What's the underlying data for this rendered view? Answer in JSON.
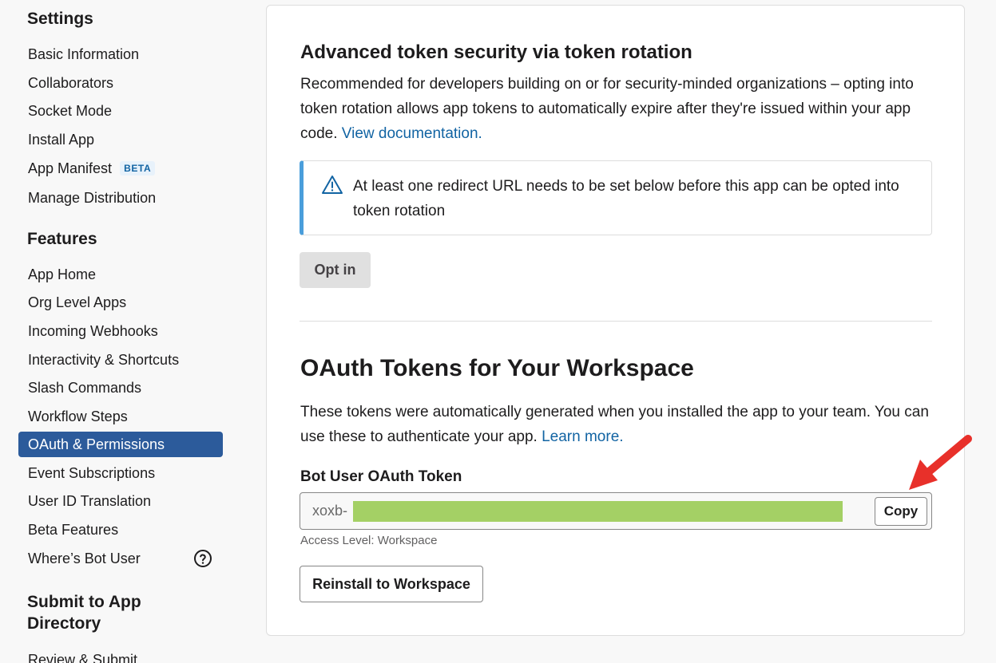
{
  "sidebar": {
    "settings_heading": "Settings",
    "settings_items": [
      {
        "label": "Basic Information"
      },
      {
        "label": "Collaborators"
      },
      {
        "label": "Socket Mode"
      },
      {
        "label": "Install App"
      },
      {
        "label": "App Manifest",
        "badge": "BETA"
      },
      {
        "label": "Manage Distribution"
      }
    ],
    "features_heading": "Features",
    "features_items": [
      {
        "label": "App Home"
      },
      {
        "label": "Org Level Apps"
      },
      {
        "label": "Incoming Webhooks"
      },
      {
        "label": "Interactivity & Shortcuts"
      },
      {
        "label": "Slash Commands"
      },
      {
        "label": "Workflow Steps"
      },
      {
        "label": "OAuth & Permissions",
        "active": true
      },
      {
        "label": "Event Subscriptions"
      },
      {
        "label": "User ID Translation"
      },
      {
        "label": "Beta Features"
      },
      {
        "label": "Where’s Bot User"
      }
    ],
    "submit_heading_line1": "Submit to App",
    "submit_heading_line2": "Directory",
    "submit_items": [
      {
        "label": "Review & Submit"
      }
    ]
  },
  "token_rotation": {
    "title": "Advanced token security via token rotation",
    "description": "Recommended for developers building on or for security-minded organizations – opting into token rotation allows app tokens to automatically expire after they're issued within your app code.",
    "doc_link": "View documentation.",
    "notice": "At least one redirect URL needs to be set below before this app can be opted into token rotation",
    "opt_in_label": "Opt in"
  },
  "oauth_tokens": {
    "title": "OAuth Tokens for Your Workspace",
    "description": "These tokens were automatically generated when you installed the app to your team. You can use these to authenticate your app.",
    "learn_more": "Learn more.",
    "bot_token_label": "Bot User OAuth Token",
    "token_prefix": "xoxb-",
    "copy_label": "Copy",
    "access_level": "Access Level: Workspace",
    "reinstall_label": "Reinstall to Workspace"
  },
  "colors": {
    "active_nav": "#2c5b9b",
    "link": "#1264a3",
    "notice_accent": "#4a9edb",
    "token_mask": "#a4d065",
    "arrow": "#e8302a"
  }
}
